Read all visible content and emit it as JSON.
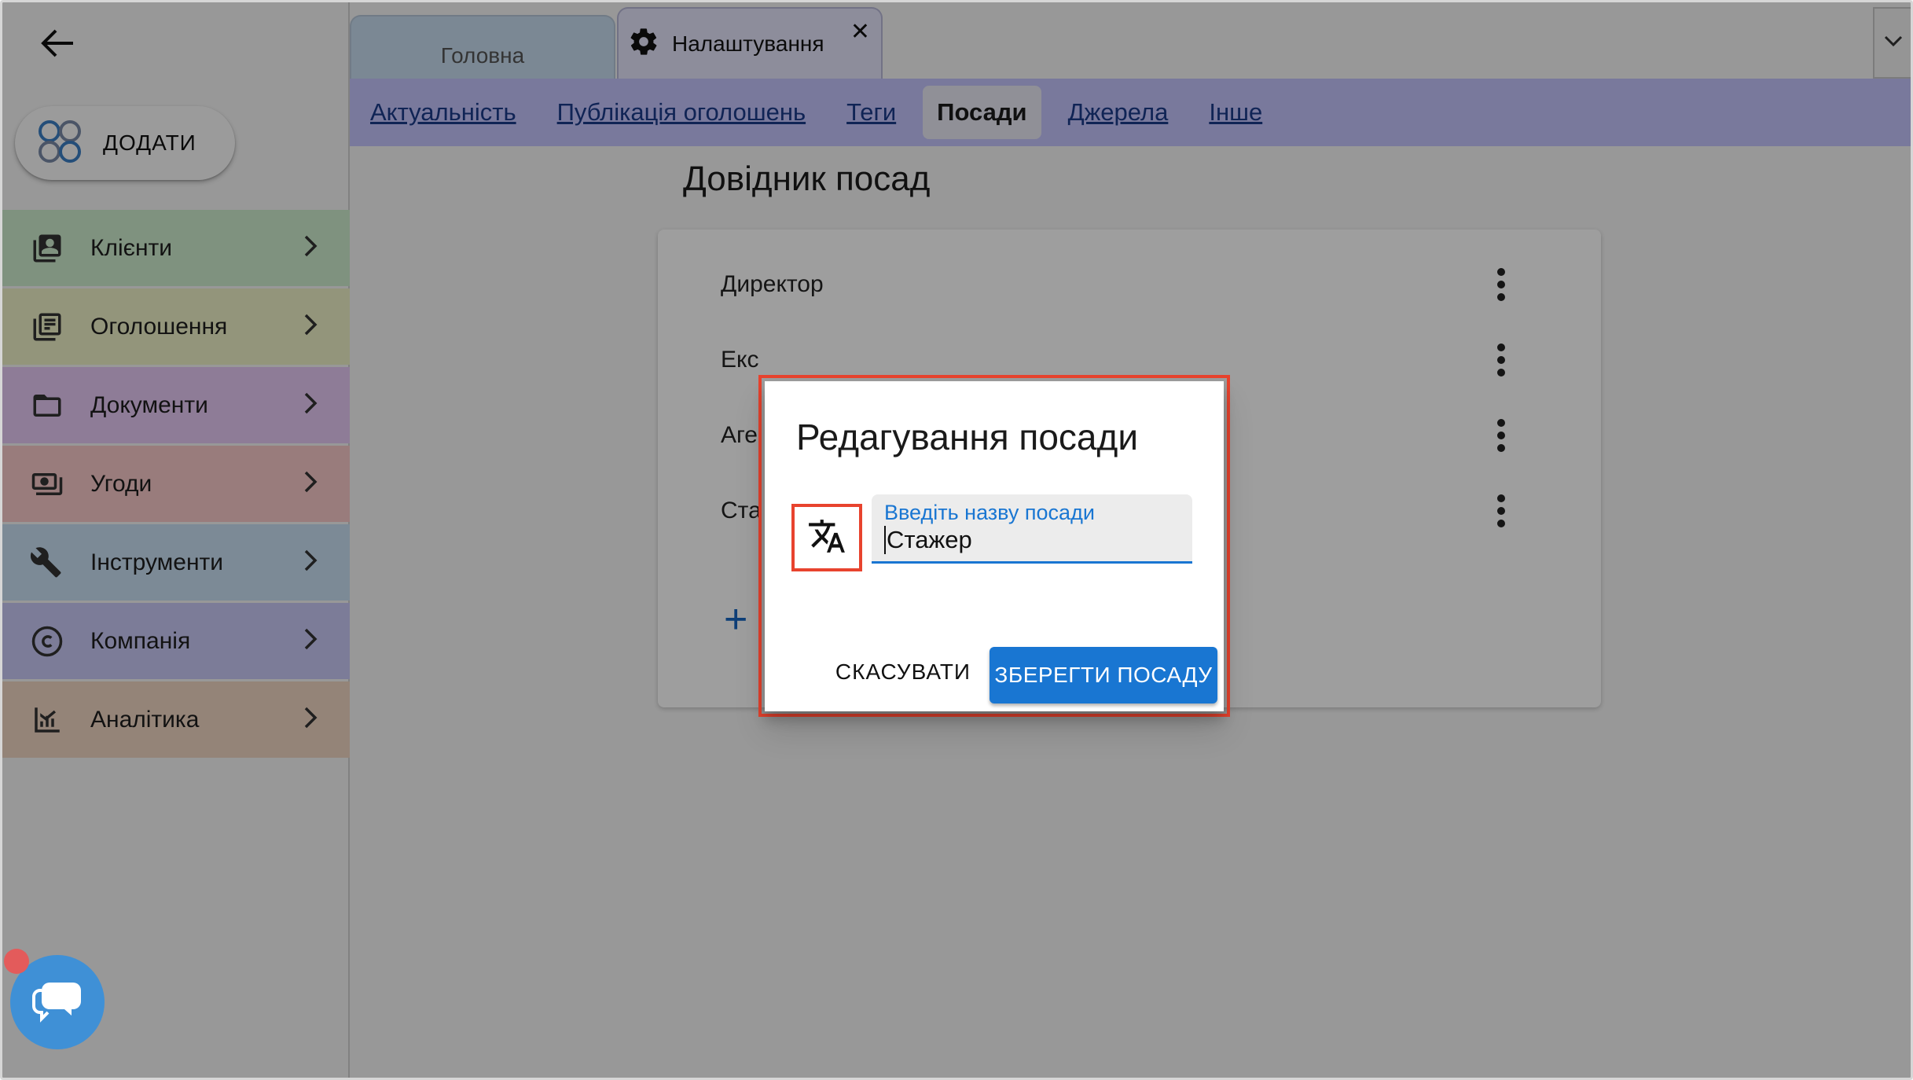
{
  "sidebar": {
    "back_icon": "arrow-left-icon",
    "add_label": "ДОДАТИ",
    "items": [
      {
        "label": "Клієнти",
        "icon": "contacts-icon",
        "color": "#cdeccd"
      },
      {
        "label": "Оголошення",
        "icon": "listings-icon",
        "color": "#eef0c7"
      },
      {
        "label": "Документи",
        "icon": "folder-icon",
        "color": "#e6c8f4"
      },
      {
        "label": "Угоди",
        "icon": "money-icon",
        "color": "#f7c9c9"
      },
      {
        "label": "Інструменти",
        "icon": "tools-icon",
        "color": "#c8dff3"
      },
      {
        "label": "Компанія",
        "icon": "copyright-icon",
        "color": "#c9c9f6"
      },
      {
        "label": "Аналітика",
        "icon": "analytics-icon",
        "color": "#efd5c2"
      }
    ]
  },
  "tabs": {
    "home": "Головна",
    "settings": "Налаштування",
    "close": "✕"
  },
  "subnav": [
    {
      "label": "Актуальність",
      "active": false
    },
    {
      "label": "Публікація оголошень",
      "active": false
    },
    {
      "label": "Теги",
      "active": false
    },
    {
      "label": "Посади",
      "active": true
    },
    {
      "label": "Джерела",
      "active": false
    },
    {
      "label": "Інше",
      "active": false
    }
  ],
  "main": {
    "title": "Довідник посад",
    "rows": [
      "Директор",
      "Екс",
      "Аге",
      "Ста"
    ],
    "add": "+"
  },
  "dialog": {
    "title": "Редагування посади",
    "field_label": "Введіть назву посади",
    "field_value": "Стажер",
    "cancel": "СКАСУВАТИ",
    "save": "ЗБЕРЕГТИ ПОСАДУ"
  },
  "colors": {
    "accent": "#1976d2",
    "highlight": "#e8432e",
    "subnav_bg": "#c3c3fc"
  }
}
